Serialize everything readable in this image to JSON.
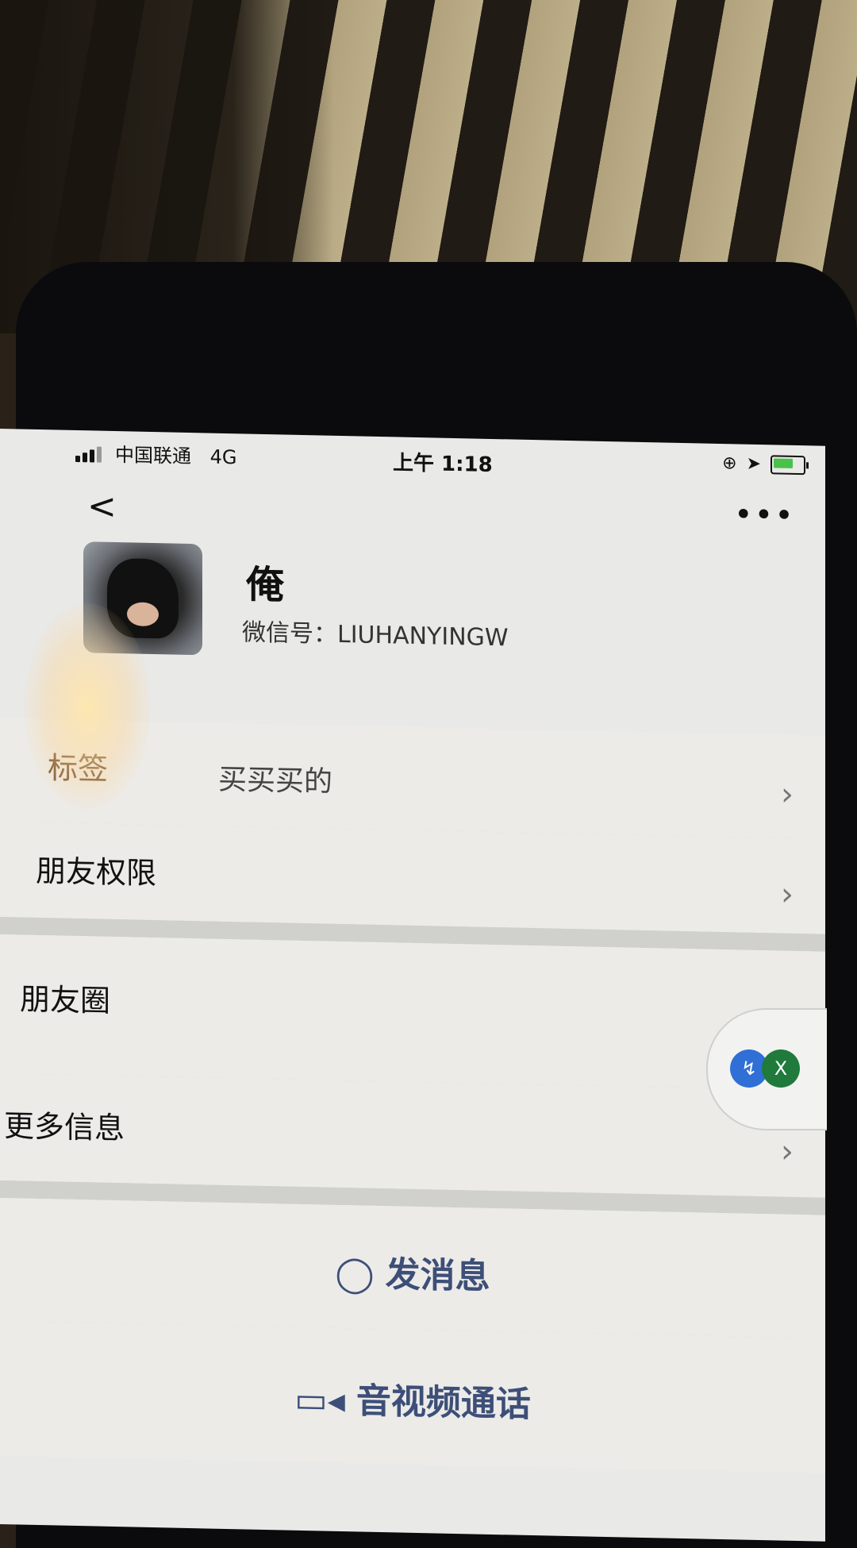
{
  "status_bar": {
    "carrier": "中国联通",
    "network": "4G",
    "time": "上午 1:18"
  },
  "icons": {
    "back": "chevron-left-icon",
    "more": "more-horizontal-icon",
    "message": "chat-bubble-icon",
    "video": "video-camera-icon"
  },
  "profile": {
    "nickname": "俺",
    "wechat_id": "微信号：LIUHANYINGW"
  },
  "rows": {
    "tag_label": "标签",
    "tag_value": "买买买的",
    "friend_permissions": "朋友权限",
    "moments": "朋友圈",
    "more_info": "更多信息"
  },
  "actions": {
    "send_message": "发消息",
    "video_call": "音视频通话"
  },
  "floating": {
    "badge_b": "X"
  },
  "colors": {
    "action_text": "#3d4f78",
    "battery_charge": "#49c24b"
  }
}
